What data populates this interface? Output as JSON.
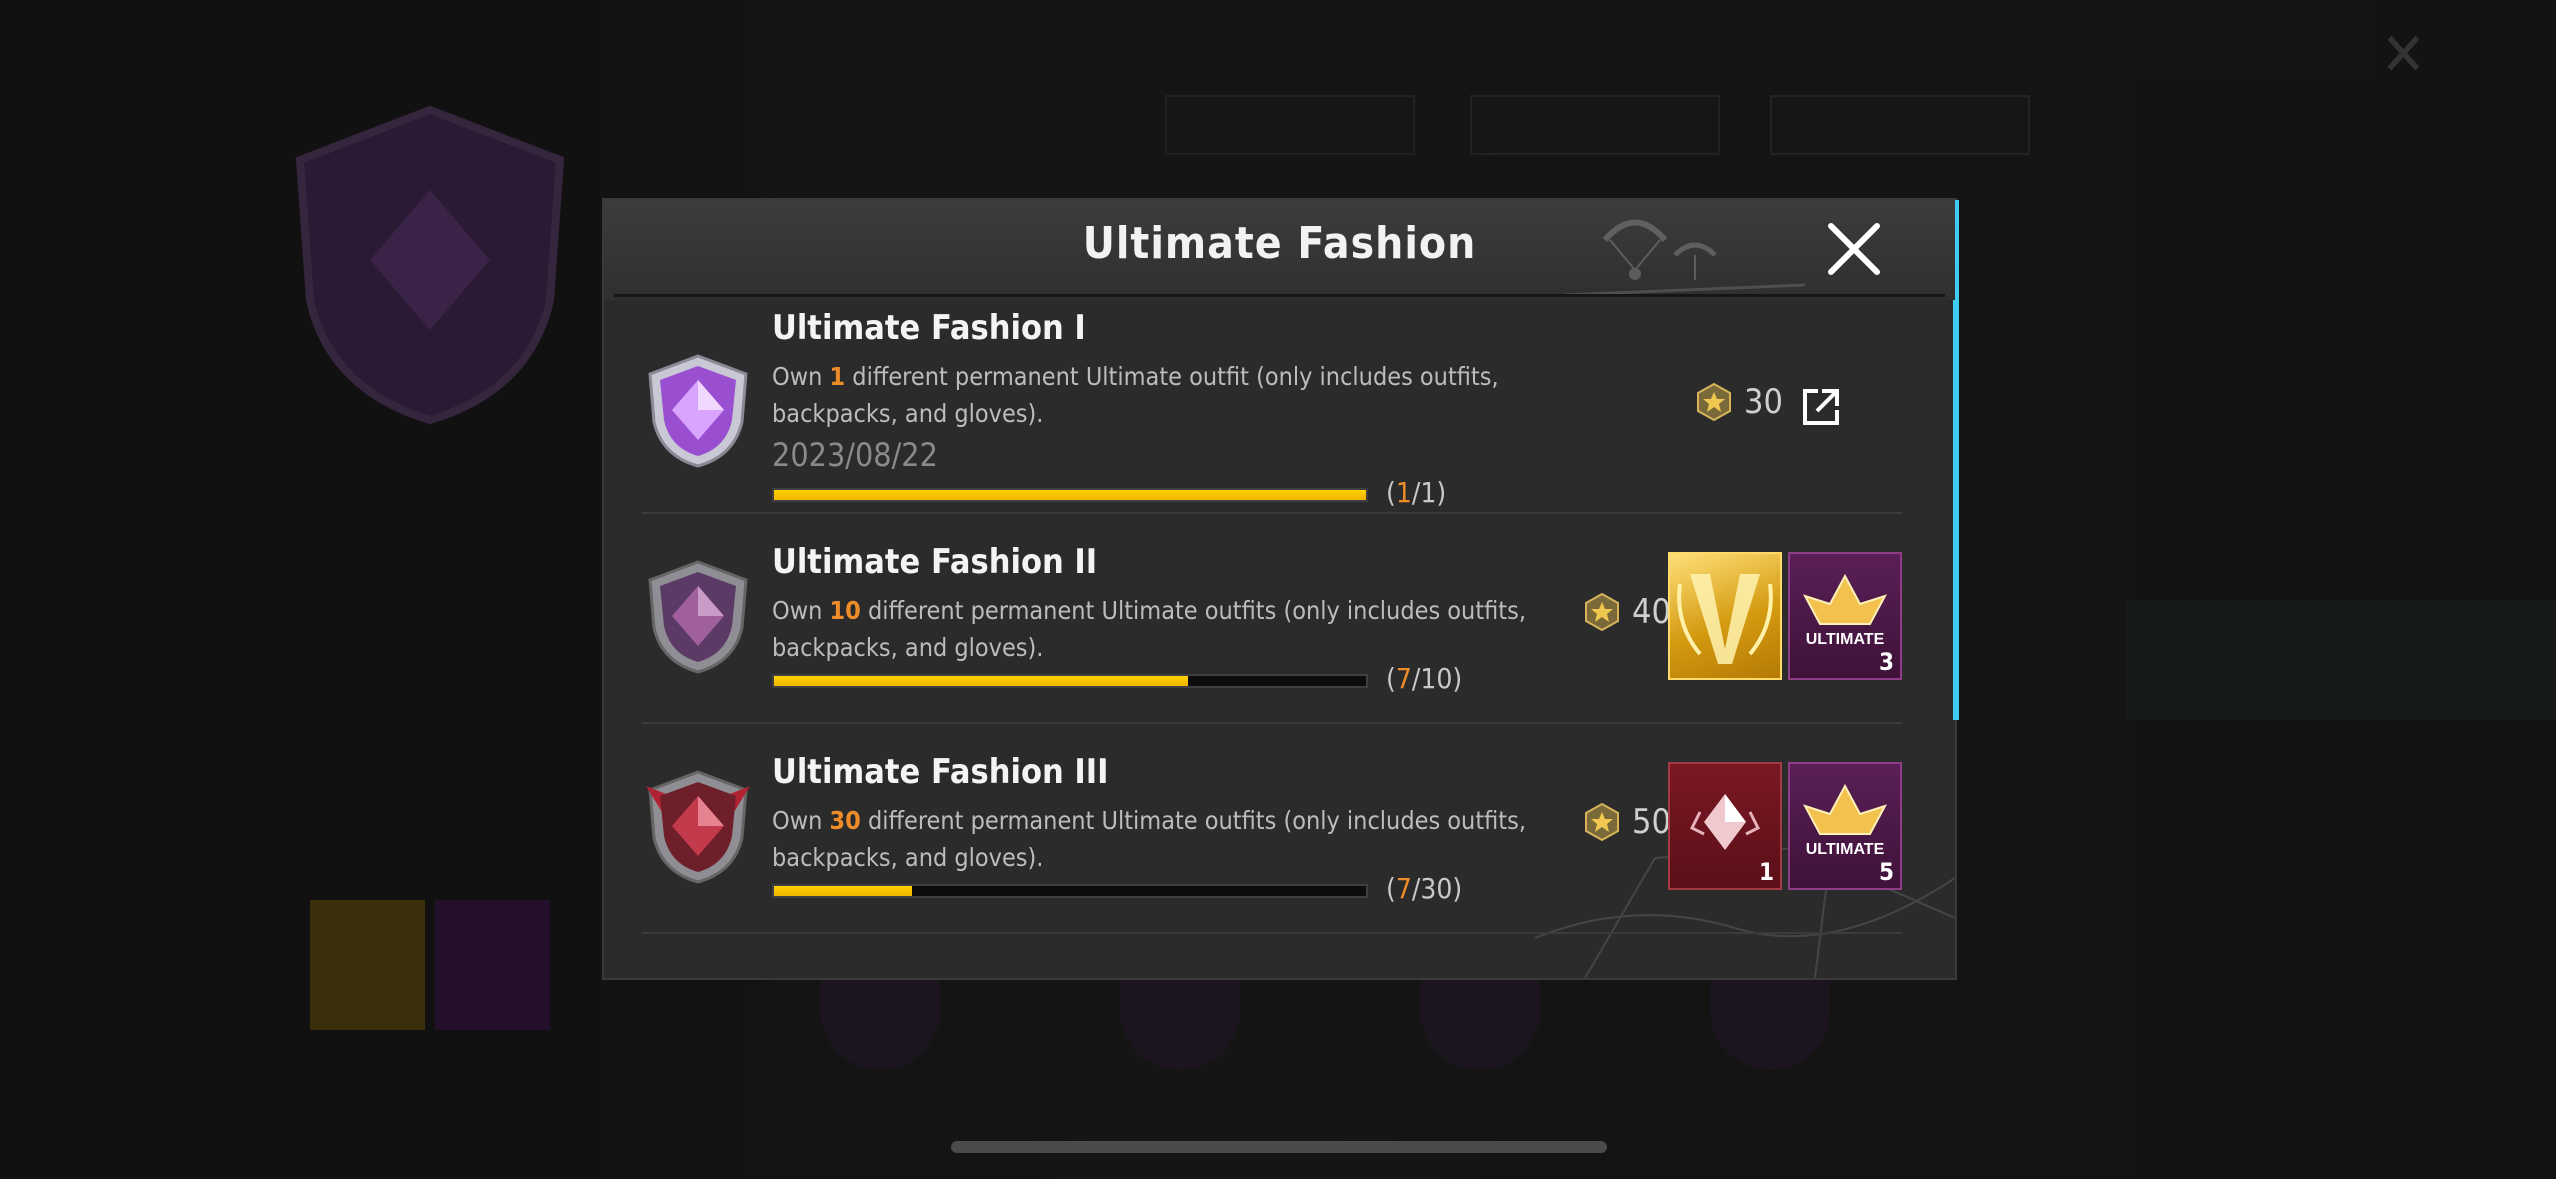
{
  "dialog": {
    "title": "Ultimate Fashion",
    "close_icon": "close-icon",
    "accent_color": "#3ecdf0"
  },
  "achievements": [
    {
      "title": "Ultimate Fashion I",
      "desc_pre": "Own ",
      "desc_num": "1",
      "desc_post": " different permanent Ultimate outfit (only includes outfits, backpacks, and gloves).",
      "date": "2023/08/22",
      "progress_current": "1",
      "progress_total": "1",
      "progress_fraction": 1.0,
      "points": "30",
      "badge_color": "#b56ee8",
      "icon": "share-icon"
    },
    {
      "title": "Ultimate Fashion II",
      "desc_pre": "Own ",
      "desc_num": "10",
      "desc_post": " different permanent Ultimate outfits (only includes outfits, backpacks, and gloves).",
      "progress_current": "7",
      "progress_total": "10",
      "progress_fraction": 0.7,
      "points": "40",
      "badge_color": "#7a4a8a",
      "rewards": [
        {
          "type": "gold-frame",
          "qty": ""
        },
        {
          "type": "ultimate-emblem",
          "qty": "3"
        }
      ]
    },
    {
      "title": "Ultimate Fashion III",
      "desc_pre": "Own ",
      "desc_num": "30",
      "desc_post": " different permanent Ultimate outfits (only includes outfits, backpacks, and gloves).",
      "progress_current": "7",
      "progress_total": "30",
      "progress_fraction": 0.233,
      "points": "50",
      "badge_color": "#a8313f",
      "rewards": [
        {
          "type": "red-diamond",
          "qty": "1"
        },
        {
          "type": "ultimate-emblem",
          "qty": "5"
        }
      ]
    }
  ],
  "count_open": "(",
  "count_sep": "/",
  "count_close": ")"
}
